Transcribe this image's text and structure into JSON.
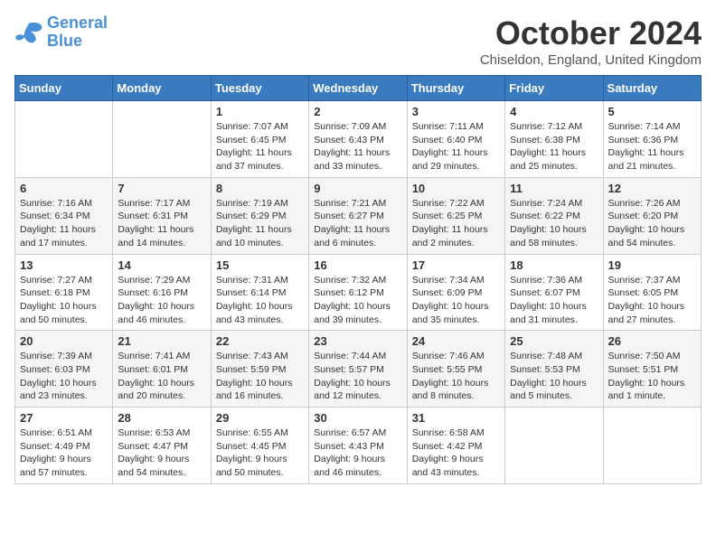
{
  "logo": {
    "line1": "General",
    "line2": "Blue"
  },
  "title": "October 2024",
  "subtitle": "Chiseldon, England, United Kingdom",
  "headers": [
    "Sunday",
    "Monday",
    "Tuesday",
    "Wednesday",
    "Thursday",
    "Friday",
    "Saturday"
  ],
  "weeks": [
    [
      {
        "day": "",
        "info": ""
      },
      {
        "day": "",
        "info": ""
      },
      {
        "day": "1",
        "info": "Sunrise: 7:07 AM\nSunset: 6:45 PM\nDaylight: 11 hours and 37 minutes."
      },
      {
        "day": "2",
        "info": "Sunrise: 7:09 AM\nSunset: 6:43 PM\nDaylight: 11 hours and 33 minutes."
      },
      {
        "day": "3",
        "info": "Sunrise: 7:11 AM\nSunset: 6:40 PM\nDaylight: 11 hours and 29 minutes."
      },
      {
        "day": "4",
        "info": "Sunrise: 7:12 AM\nSunset: 6:38 PM\nDaylight: 11 hours and 25 minutes."
      },
      {
        "day": "5",
        "info": "Sunrise: 7:14 AM\nSunset: 6:36 PM\nDaylight: 11 hours and 21 minutes."
      }
    ],
    [
      {
        "day": "6",
        "info": "Sunrise: 7:16 AM\nSunset: 6:34 PM\nDaylight: 11 hours and 17 minutes."
      },
      {
        "day": "7",
        "info": "Sunrise: 7:17 AM\nSunset: 6:31 PM\nDaylight: 11 hours and 14 minutes."
      },
      {
        "day": "8",
        "info": "Sunrise: 7:19 AM\nSunset: 6:29 PM\nDaylight: 11 hours and 10 minutes."
      },
      {
        "day": "9",
        "info": "Sunrise: 7:21 AM\nSunset: 6:27 PM\nDaylight: 11 hours and 6 minutes."
      },
      {
        "day": "10",
        "info": "Sunrise: 7:22 AM\nSunset: 6:25 PM\nDaylight: 11 hours and 2 minutes."
      },
      {
        "day": "11",
        "info": "Sunrise: 7:24 AM\nSunset: 6:22 PM\nDaylight: 10 hours and 58 minutes."
      },
      {
        "day": "12",
        "info": "Sunrise: 7:26 AM\nSunset: 6:20 PM\nDaylight: 10 hours and 54 minutes."
      }
    ],
    [
      {
        "day": "13",
        "info": "Sunrise: 7:27 AM\nSunset: 6:18 PM\nDaylight: 10 hours and 50 minutes."
      },
      {
        "day": "14",
        "info": "Sunrise: 7:29 AM\nSunset: 6:16 PM\nDaylight: 10 hours and 46 minutes."
      },
      {
        "day": "15",
        "info": "Sunrise: 7:31 AM\nSunset: 6:14 PM\nDaylight: 10 hours and 43 minutes."
      },
      {
        "day": "16",
        "info": "Sunrise: 7:32 AM\nSunset: 6:12 PM\nDaylight: 10 hours and 39 minutes."
      },
      {
        "day": "17",
        "info": "Sunrise: 7:34 AM\nSunset: 6:09 PM\nDaylight: 10 hours and 35 minutes."
      },
      {
        "day": "18",
        "info": "Sunrise: 7:36 AM\nSunset: 6:07 PM\nDaylight: 10 hours and 31 minutes."
      },
      {
        "day": "19",
        "info": "Sunrise: 7:37 AM\nSunset: 6:05 PM\nDaylight: 10 hours and 27 minutes."
      }
    ],
    [
      {
        "day": "20",
        "info": "Sunrise: 7:39 AM\nSunset: 6:03 PM\nDaylight: 10 hours and 23 minutes."
      },
      {
        "day": "21",
        "info": "Sunrise: 7:41 AM\nSunset: 6:01 PM\nDaylight: 10 hours and 20 minutes."
      },
      {
        "day": "22",
        "info": "Sunrise: 7:43 AM\nSunset: 5:59 PM\nDaylight: 10 hours and 16 minutes."
      },
      {
        "day": "23",
        "info": "Sunrise: 7:44 AM\nSunset: 5:57 PM\nDaylight: 10 hours and 12 minutes."
      },
      {
        "day": "24",
        "info": "Sunrise: 7:46 AM\nSunset: 5:55 PM\nDaylight: 10 hours and 8 minutes."
      },
      {
        "day": "25",
        "info": "Sunrise: 7:48 AM\nSunset: 5:53 PM\nDaylight: 10 hours and 5 minutes."
      },
      {
        "day": "26",
        "info": "Sunrise: 7:50 AM\nSunset: 5:51 PM\nDaylight: 10 hours and 1 minute."
      }
    ],
    [
      {
        "day": "27",
        "info": "Sunrise: 6:51 AM\nSunset: 4:49 PM\nDaylight: 9 hours and 57 minutes."
      },
      {
        "day": "28",
        "info": "Sunrise: 6:53 AM\nSunset: 4:47 PM\nDaylight: 9 hours and 54 minutes."
      },
      {
        "day": "29",
        "info": "Sunrise: 6:55 AM\nSunset: 4:45 PM\nDaylight: 9 hours and 50 minutes."
      },
      {
        "day": "30",
        "info": "Sunrise: 6:57 AM\nSunset: 4:43 PM\nDaylight: 9 hours and 46 minutes."
      },
      {
        "day": "31",
        "info": "Sunrise: 6:58 AM\nSunset: 4:42 PM\nDaylight: 9 hours and 43 minutes."
      },
      {
        "day": "",
        "info": ""
      },
      {
        "day": "",
        "info": ""
      }
    ]
  ]
}
